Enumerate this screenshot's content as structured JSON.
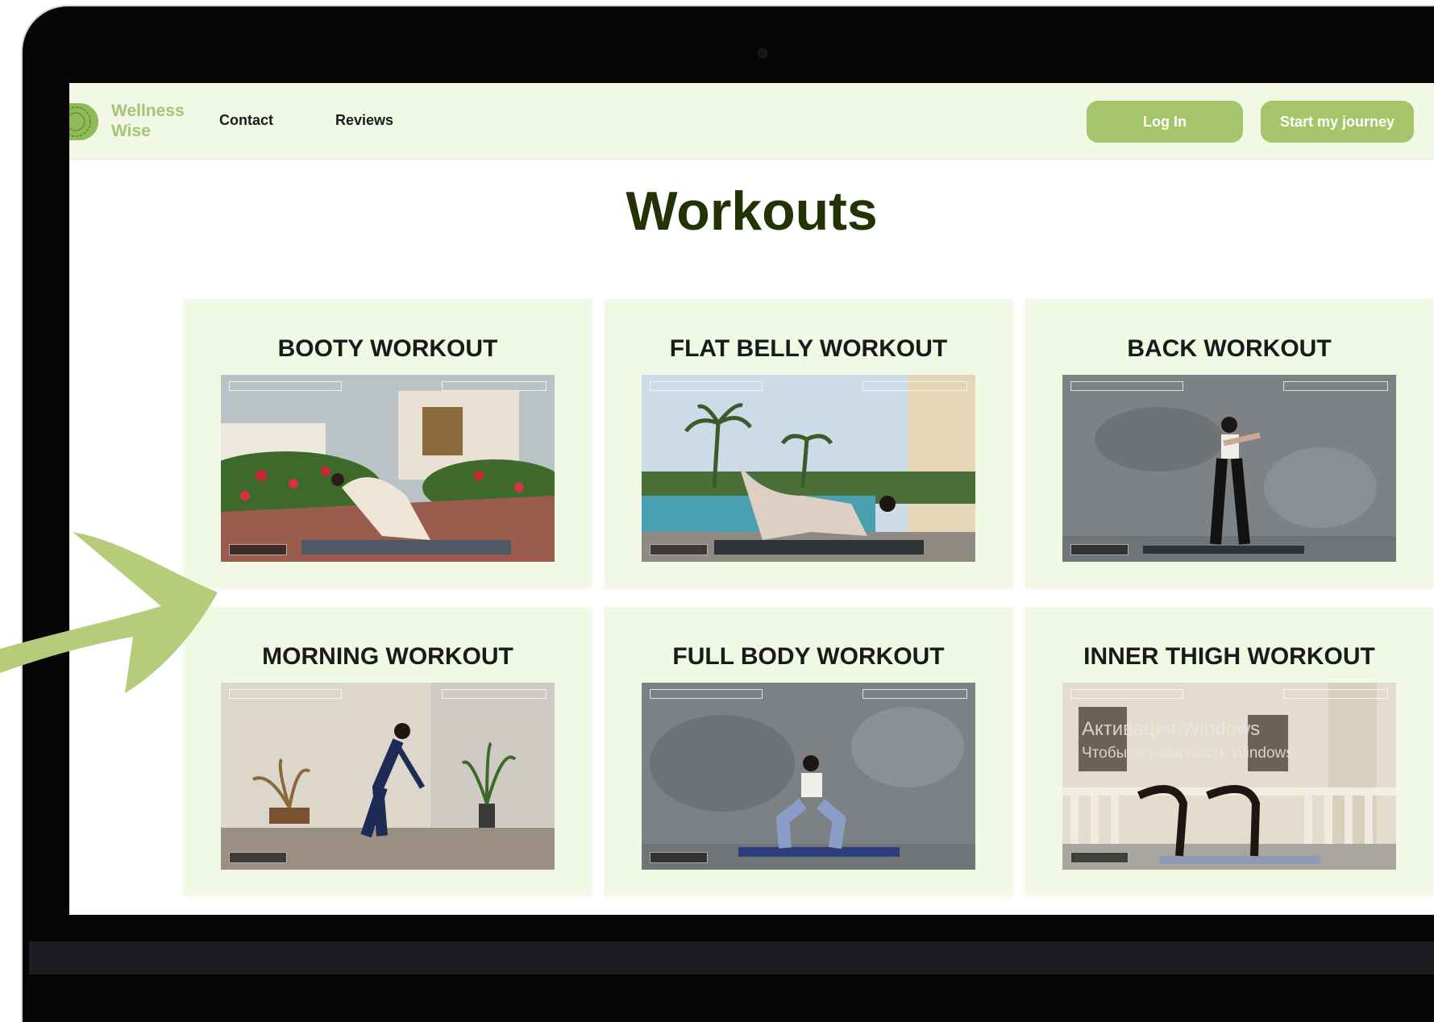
{
  "header": {
    "brand_line1": "Wellness",
    "brand_line2": "Wise",
    "nav": [
      "Contact",
      "Reviews"
    ],
    "login_label": "Log In",
    "start_label": "Start my journey"
  },
  "main": {
    "title": "Workouts",
    "cards": [
      {
        "title": "BOOTY WORKOUT"
      },
      {
        "title": "FLAT BELLY WORKOUT"
      },
      {
        "title": "BACK WORKOUT"
      },
      {
        "title": "MORNING WORKOUT"
      },
      {
        "title": "FULL BODY WORKOUT"
      },
      {
        "title": "INNER THIGH WORKOUT"
      }
    ]
  },
  "watermark": {
    "line1": "Активация Windows",
    "line2": "Чтобы активировать Windows"
  },
  "colors": {
    "accent": "#a5c56a",
    "header_bg": "#f1f8e3",
    "title": "#243306",
    "arrow": "#b6cc7a"
  },
  "icons": [
    "logo-icon",
    "arrow-icon"
  ]
}
